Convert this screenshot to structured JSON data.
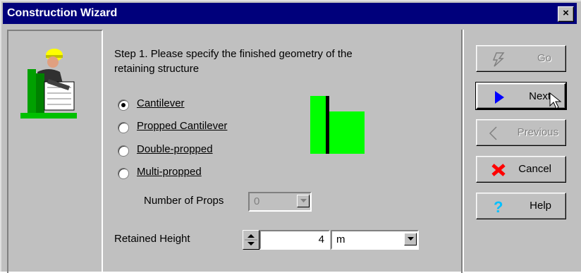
{
  "window": {
    "title": "Construction Wizard",
    "close_label": "×"
  },
  "step": {
    "text_line1": "Step 1. Please specify the finished geometry of the",
    "text_line2": "retaining structure"
  },
  "options": [
    {
      "label": "Cantilever",
      "checked": true
    },
    {
      "label": "Propped Cantilever",
      "checked": false
    },
    {
      "label": "Double-propped",
      "checked": false
    },
    {
      "label": "Multi-propped",
      "checked": false
    }
  ],
  "props": {
    "label": "Number of Props",
    "value": "0"
  },
  "height": {
    "label": "Retained Height",
    "value": "4",
    "unit": "m"
  },
  "buttons": {
    "go": "Go",
    "next": "Next",
    "previous": "Previous",
    "cancel": "Cancel",
    "help": "Help"
  },
  "colors": {
    "title_bar": "#00007b",
    "preview_green": "#00ff00",
    "next_arrow": "#0000ff",
    "cancel_x": "#ff0000",
    "help_q": "#00c0ff"
  }
}
